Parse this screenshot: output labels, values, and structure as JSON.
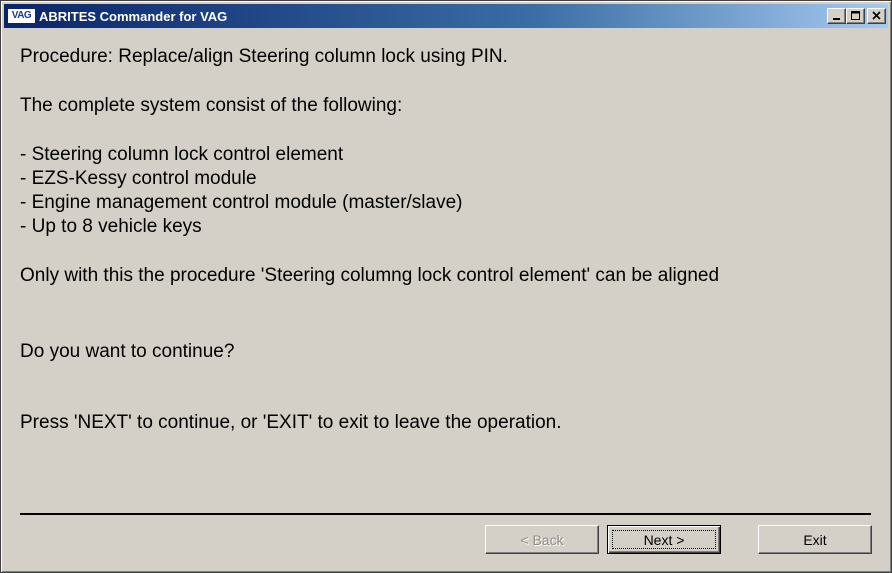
{
  "window": {
    "icon_text": "VAG",
    "title": "ABRITES Commander for VAG"
  },
  "content": {
    "procedure": "Procedure: Replace/align Steering column lock using PIN.",
    "system_intro": "The complete system consist of the following:",
    "items": [
      "- Steering column lock control element",
      "- EZS-Kessy control module",
      "- Engine management control module (master/slave)",
      "- Up to 8 vehicle keys"
    ],
    "alignment_note": "Only with this the procedure 'Steering columng lock control element' can be aligned",
    "question": "Do you want to continue?",
    "instruction": "Press 'NEXT' to  continue, or 'EXIT' to exit to leave the operation."
  },
  "buttons": {
    "back": "< Back",
    "next": "Next >",
    "exit": "Exit",
    "back_enabled": false
  }
}
